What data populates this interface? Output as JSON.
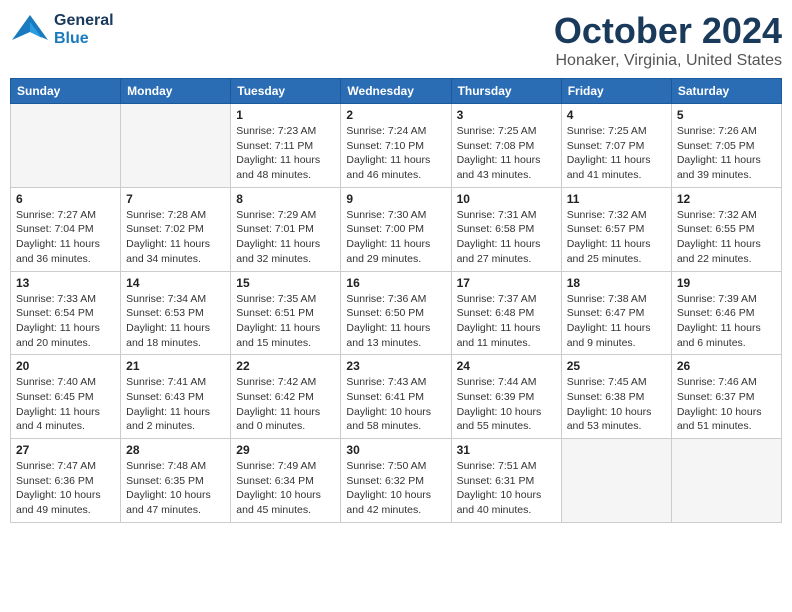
{
  "header": {
    "logo": {
      "general": "General",
      "blue": "Blue"
    },
    "title": "October 2024",
    "location": "Honaker, Virginia, United States"
  },
  "weekdays": [
    "Sunday",
    "Monday",
    "Tuesday",
    "Wednesday",
    "Thursday",
    "Friday",
    "Saturday"
  ],
  "weeks": [
    [
      {
        "day": "",
        "info": ""
      },
      {
        "day": "",
        "info": ""
      },
      {
        "day": "1",
        "info": "Sunrise: 7:23 AM\nSunset: 7:11 PM\nDaylight: 11 hours\nand 48 minutes."
      },
      {
        "day": "2",
        "info": "Sunrise: 7:24 AM\nSunset: 7:10 PM\nDaylight: 11 hours\nand 46 minutes."
      },
      {
        "day": "3",
        "info": "Sunrise: 7:25 AM\nSunset: 7:08 PM\nDaylight: 11 hours\nand 43 minutes."
      },
      {
        "day": "4",
        "info": "Sunrise: 7:25 AM\nSunset: 7:07 PM\nDaylight: 11 hours\nand 41 minutes."
      },
      {
        "day": "5",
        "info": "Sunrise: 7:26 AM\nSunset: 7:05 PM\nDaylight: 11 hours\nand 39 minutes."
      }
    ],
    [
      {
        "day": "6",
        "info": "Sunrise: 7:27 AM\nSunset: 7:04 PM\nDaylight: 11 hours\nand 36 minutes."
      },
      {
        "day": "7",
        "info": "Sunrise: 7:28 AM\nSunset: 7:02 PM\nDaylight: 11 hours\nand 34 minutes."
      },
      {
        "day": "8",
        "info": "Sunrise: 7:29 AM\nSunset: 7:01 PM\nDaylight: 11 hours\nand 32 minutes."
      },
      {
        "day": "9",
        "info": "Sunrise: 7:30 AM\nSunset: 7:00 PM\nDaylight: 11 hours\nand 29 minutes."
      },
      {
        "day": "10",
        "info": "Sunrise: 7:31 AM\nSunset: 6:58 PM\nDaylight: 11 hours\nand 27 minutes."
      },
      {
        "day": "11",
        "info": "Sunrise: 7:32 AM\nSunset: 6:57 PM\nDaylight: 11 hours\nand 25 minutes."
      },
      {
        "day": "12",
        "info": "Sunrise: 7:32 AM\nSunset: 6:55 PM\nDaylight: 11 hours\nand 22 minutes."
      }
    ],
    [
      {
        "day": "13",
        "info": "Sunrise: 7:33 AM\nSunset: 6:54 PM\nDaylight: 11 hours\nand 20 minutes."
      },
      {
        "day": "14",
        "info": "Sunrise: 7:34 AM\nSunset: 6:53 PM\nDaylight: 11 hours\nand 18 minutes."
      },
      {
        "day": "15",
        "info": "Sunrise: 7:35 AM\nSunset: 6:51 PM\nDaylight: 11 hours\nand 15 minutes."
      },
      {
        "day": "16",
        "info": "Sunrise: 7:36 AM\nSunset: 6:50 PM\nDaylight: 11 hours\nand 13 minutes."
      },
      {
        "day": "17",
        "info": "Sunrise: 7:37 AM\nSunset: 6:48 PM\nDaylight: 11 hours\nand 11 minutes."
      },
      {
        "day": "18",
        "info": "Sunrise: 7:38 AM\nSunset: 6:47 PM\nDaylight: 11 hours\nand 9 minutes."
      },
      {
        "day": "19",
        "info": "Sunrise: 7:39 AM\nSunset: 6:46 PM\nDaylight: 11 hours\nand 6 minutes."
      }
    ],
    [
      {
        "day": "20",
        "info": "Sunrise: 7:40 AM\nSunset: 6:45 PM\nDaylight: 11 hours\nand 4 minutes."
      },
      {
        "day": "21",
        "info": "Sunrise: 7:41 AM\nSunset: 6:43 PM\nDaylight: 11 hours\nand 2 minutes."
      },
      {
        "day": "22",
        "info": "Sunrise: 7:42 AM\nSunset: 6:42 PM\nDaylight: 11 hours\nand 0 minutes."
      },
      {
        "day": "23",
        "info": "Sunrise: 7:43 AM\nSunset: 6:41 PM\nDaylight: 10 hours\nand 58 minutes."
      },
      {
        "day": "24",
        "info": "Sunrise: 7:44 AM\nSunset: 6:39 PM\nDaylight: 10 hours\nand 55 minutes."
      },
      {
        "day": "25",
        "info": "Sunrise: 7:45 AM\nSunset: 6:38 PM\nDaylight: 10 hours\nand 53 minutes."
      },
      {
        "day": "26",
        "info": "Sunrise: 7:46 AM\nSunset: 6:37 PM\nDaylight: 10 hours\nand 51 minutes."
      }
    ],
    [
      {
        "day": "27",
        "info": "Sunrise: 7:47 AM\nSunset: 6:36 PM\nDaylight: 10 hours\nand 49 minutes."
      },
      {
        "day": "28",
        "info": "Sunrise: 7:48 AM\nSunset: 6:35 PM\nDaylight: 10 hours\nand 47 minutes."
      },
      {
        "day": "29",
        "info": "Sunrise: 7:49 AM\nSunset: 6:34 PM\nDaylight: 10 hours\nand 45 minutes."
      },
      {
        "day": "30",
        "info": "Sunrise: 7:50 AM\nSunset: 6:32 PM\nDaylight: 10 hours\nand 42 minutes."
      },
      {
        "day": "31",
        "info": "Sunrise: 7:51 AM\nSunset: 6:31 PM\nDaylight: 10 hours\nand 40 minutes."
      },
      {
        "day": "",
        "info": ""
      },
      {
        "day": "",
        "info": ""
      }
    ]
  ]
}
